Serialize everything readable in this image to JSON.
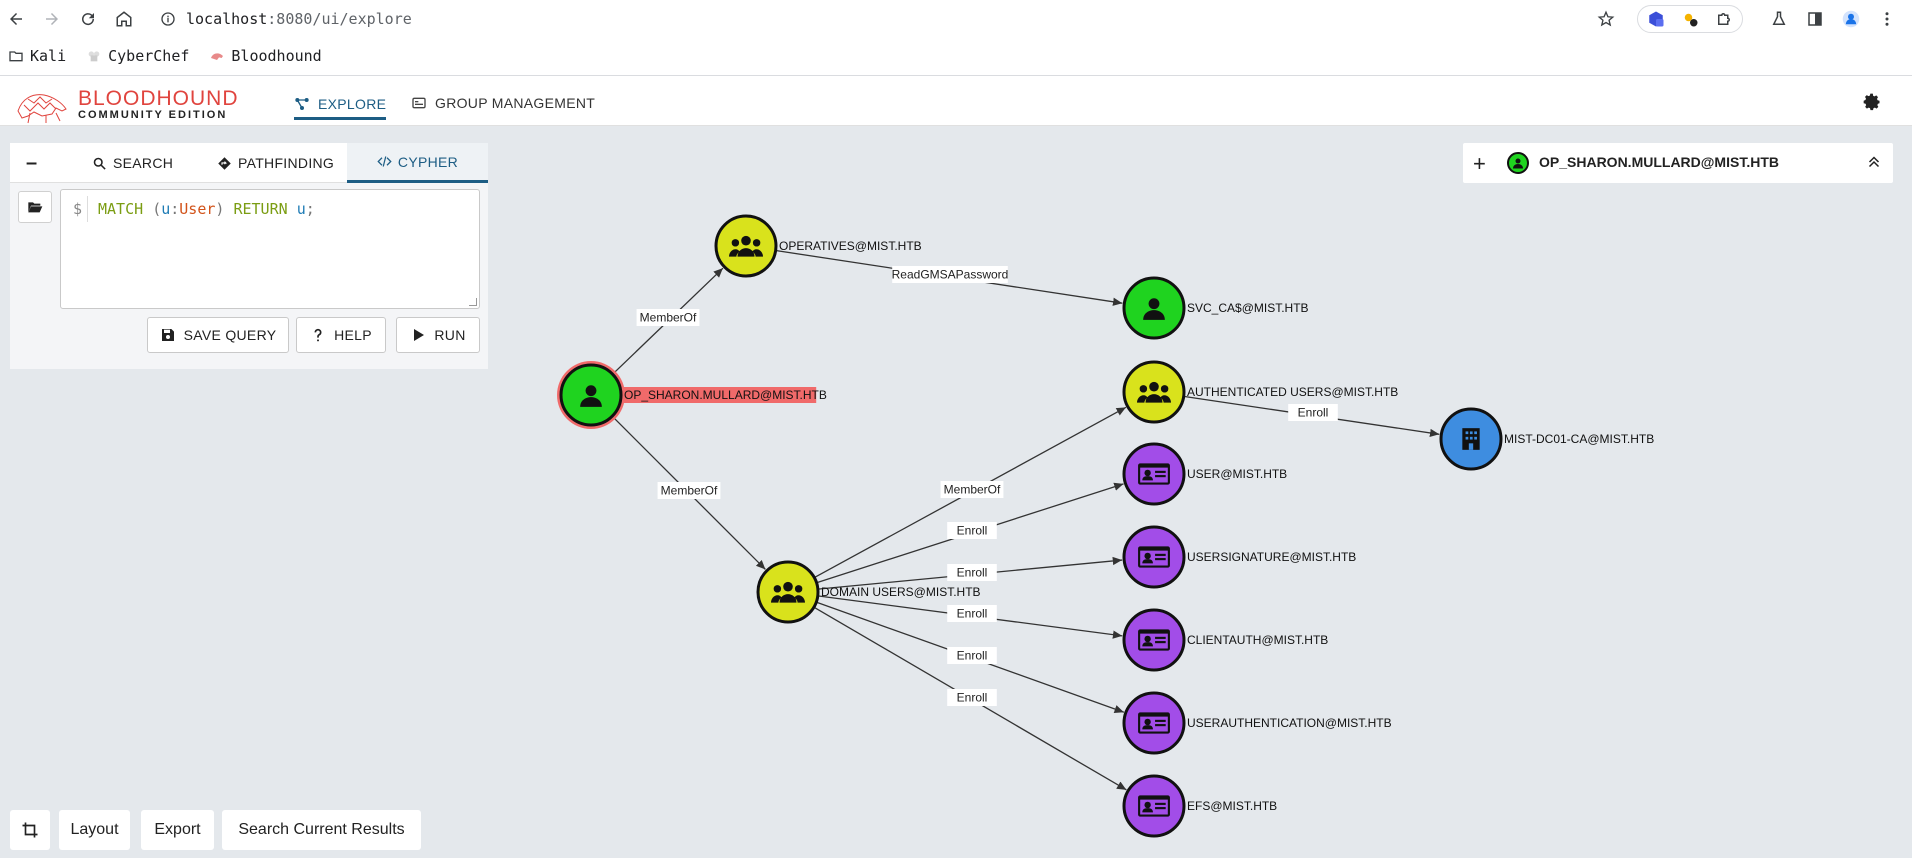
{
  "browser": {
    "url_host": "localhost",
    "url_rest": ":8080/ui/explore",
    "bookmarks": [
      "Kali",
      "CyberChef",
      "Bloodhound"
    ],
    "extension_badge": "6"
  },
  "app": {
    "logo_line1": "BLOODHOUND",
    "logo_line2": "COMMUNITY EDITION",
    "nav": [
      "EXPLORE",
      "GROUP MANAGEMENT"
    ]
  },
  "query_panel": {
    "collapse": "–",
    "tabs": [
      "SEARCH",
      "PATHFINDING",
      "CYPHER"
    ],
    "prompt": "$",
    "cypher_tokens": [
      {
        "text": "MATCH ",
        "kind": "k"
      },
      {
        "text": "(",
        "kind": "p"
      },
      {
        "text": "u",
        "kind": "v"
      },
      {
        "text": ":",
        "kind": "p"
      },
      {
        "text": "User",
        "kind": "t"
      },
      {
        "text": ") ",
        "kind": "p"
      },
      {
        "text": "RETURN ",
        "kind": "k"
      },
      {
        "text": "u",
        "kind": "v"
      },
      {
        "text": ";",
        "kind": "p"
      }
    ],
    "buttons": [
      "SAVE QUERY",
      "HELP",
      "RUN"
    ]
  },
  "selected_node": {
    "name": "OP_SHARON.MULLARD@MIST.HTB"
  },
  "graph": {
    "colors": {
      "user": "#1fd31f",
      "group": "#d9e21c",
      "template": "#a24de8",
      "enterprise_ca": "#3e8de0",
      "selected_ring": "#f06a6a"
    },
    "nodes": [
      {
        "id": "sharon",
        "label": "OP_SHARON.MULLARD@MIST.HTB",
        "type": "user",
        "selected": true
      },
      {
        "id": "operatives",
        "label": "OPERATIVES@MIST.HTB",
        "type": "group"
      },
      {
        "id": "svcca",
        "label": "SVC_CA$@MIST.HTB",
        "type": "user"
      },
      {
        "id": "authusers",
        "label": "AUTHENTICATED USERS@MIST.HTB",
        "type": "group"
      },
      {
        "id": "ca",
        "label": "MIST-DC01-CA@MIST.HTB",
        "type": "enterprise_ca"
      },
      {
        "id": "domainusers",
        "label": "DOMAIN USERS@MIST.HTB",
        "type": "group"
      },
      {
        "id": "user",
        "label": "USER@MIST.HTB",
        "type": "template"
      },
      {
        "id": "usersig",
        "label": "USERSIGNATURE@MIST.HTB",
        "type": "template"
      },
      {
        "id": "clientauth",
        "label": "CLIENTAUTH@MIST.HTB",
        "type": "template"
      },
      {
        "id": "userauth",
        "label": "USERAUTHENTICATION@MIST.HTB",
        "type": "template"
      },
      {
        "id": "efs",
        "label": "EFS@MIST.HTB",
        "type": "template"
      }
    ],
    "edges": [
      {
        "from": "sharon",
        "to": "operatives",
        "label": "MemberOf"
      },
      {
        "from": "sharon",
        "to": "domainusers",
        "label": "MemberOf"
      },
      {
        "from": "operatives",
        "to": "svcca",
        "label": "ReadGMSAPassword"
      },
      {
        "from": "domainusers",
        "to": "authusers",
        "label": "MemberOf"
      },
      {
        "from": "authusers",
        "to": "ca",
        "label": "Enroll"
      },
      {
        "from": "domainusers",
        "to": "user",
        "label": "Enroll"
      },
      {
        "from": "domainusers",
        "to": "usersig",
        "label": "Enroll"
      },
      {
        "from": "domainusers",
        "to": "clientauth",
        "label": "Enroll"
      },
      {
        "from": "domainusers",
        "to": "userauth",
        "label": "Enroll"
      },
      {
        "from": "domainusers",
        "to": "efs",
        "label": "Enroll"
      }
    ]
  },
  "bottom_buttons": [
    "Layout",
    "Export",
    "Search Current Results"
  ]
}
